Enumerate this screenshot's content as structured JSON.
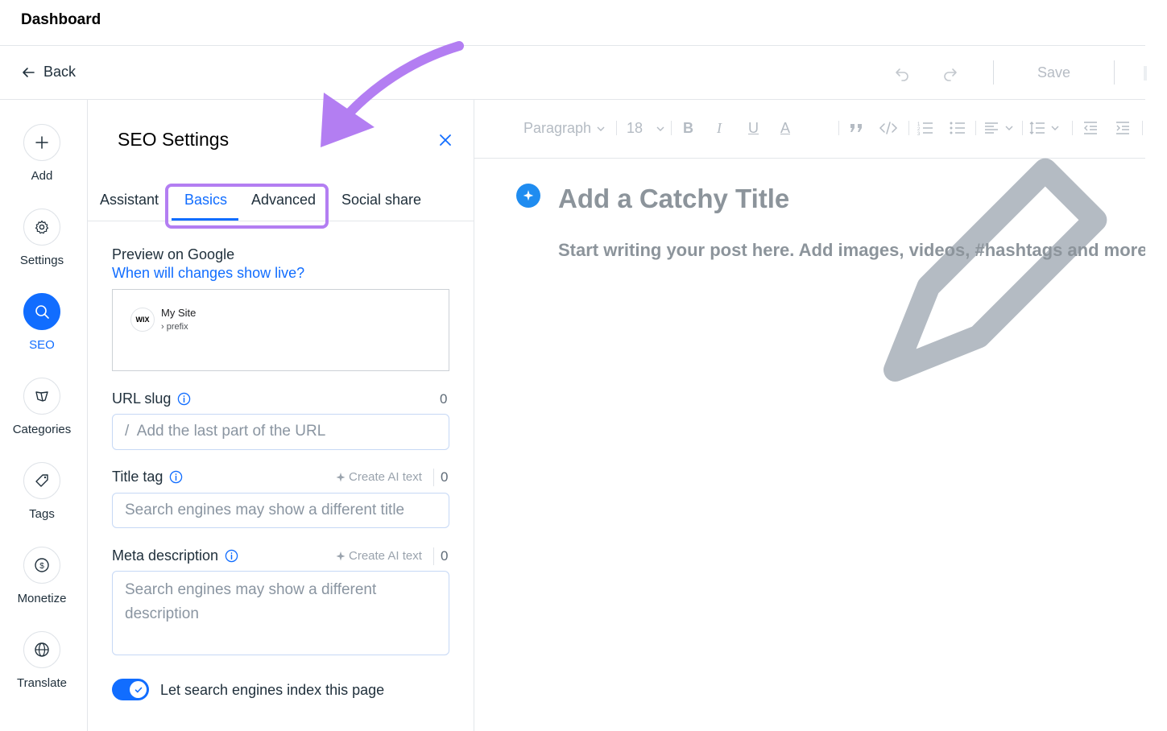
{
  "topbar": {
    "title": "Dashboard"
  },
  "header": {
    "back_label": "Back",
    "save_label": "Save"
  },
  "rail": {
    "items": [
      {
        "label": "Add",
        "icon": "plus-icon"
      },
      {
        "label": "Settings",
        "icon": "gear-icon"
      },
      {
        "label": "SEO",
        "icon": "search-icon",
        "active": true
      },
      {
        "label": "Categories",
        "icon": "categories-icon"
      },
      {
        "label": "Tags",
        "icon": "tag-icon"
      },
      {
        "label": "Monetize",
        "icon": "dollar-icon"
      },
      {
        "label": "Translate",
        "icon": "globe-icon"
      }
    ]
  },
  "panel": {
    "title": "SEO Settings",
    "tabs": [
      "Assistant",
      "Basics",
      "Advanced",
      "Social share"
    ],
    "active_tab": "Basics",
    "preview_label": "Preview on Google",
    "preview_link": "When will changes show live?",
    "preview": {
      "logo_text": "WIX",
      "site_name": "My Site",
      "path": "› prefix"
    },
    "url_slug": {
      "label": "URL slug",
      "count": "0",
      "prefix": "/",
      "placeholder": "Add the last part of the URL"
    },
    "title_tag": {
      "label": "Title tag",
      "ai_label": "Create AI text",
      "count": "0",
      "placeholder": "Search engines may show a different title"
    },
    "meta_description": {
      "label": "Meta description",
      "ai_label": "Create AI text",
      "count": "0",
      "placeholder": "Search engines may show a different description"
    },
    "index_toggle": {
      "label": "Let search engines index this page",
      "on": true
    }
  },
  "editor": {
    "toolbar": {
      "paragraph": "Paragraph",
      "font_size": "18"
    },
    "title_placeholder": "Add a Catchy Title",
    "body_placeholder": "Start writing your post here. Add images, videos, #hashtags and more"
  },
  "colors": {
    "accent": "#116dff",
    "annotation": "#b37ef2"
  }
}
